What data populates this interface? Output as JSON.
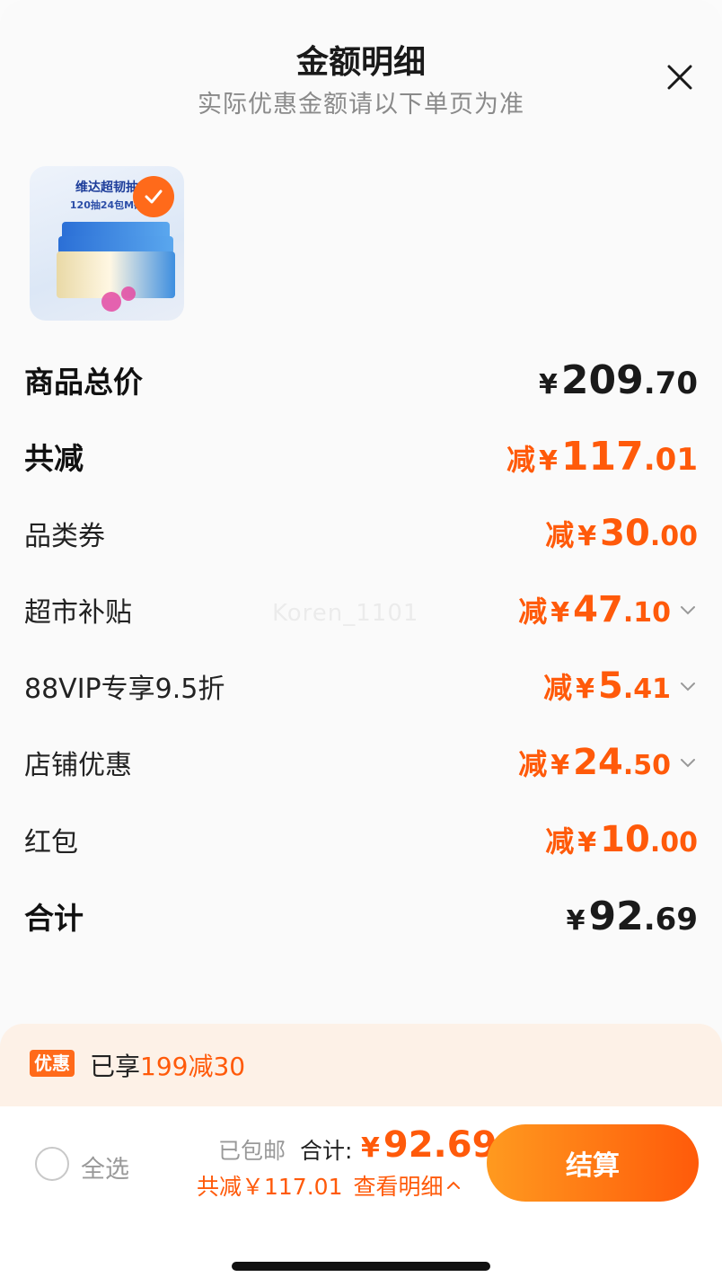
{
  "header": {
    "title": "金额明细",
    "subtitle": "实际优惠金额请以下单页为准"
  },
  "product": {
    "thumb_title": "维达超韧抽",
    "thumb_subtitle": "120抽24包M码"
  },
  "rows": {
    "subtotal": {
      "label": "商品总价",
      "yen": "¥",
      "int": "209",
      "dec": ".70"
    },
    "total_discount": {
      "label": "共减",
      "prefix": "减",
      "yen": "¥",
      "int": "117",
      "dec": ".01"
    },
    "category_coupon": {
      "label": "品类券",
      "prefix": "减",
      "yen": "¥",
      "int": "30",
      "dec": ".00"
    },
    "supermarket_subsidy": {
      "label": "超市补贴",
      "prefix": "减",
      "yen": "¥",
      "int": "47",
      "dec": ".10"
    },
    "vip_discount": {
      "label": "88VIP专享9.5折",
      "prefix": "减",
      "yen": "¥",
      "int": "5",
      "dec": ".41"
    },
    "store_discount": {
      "label": "店铺优惠",
      "prefix": "减",
      "yen": "¥",
      "int": "24",
      "dec": ".50"
    },
    "red_packet": {
      "label": "红包",
      "prefix": "减",
      "yen": "¥",
      "int": "10",
      "dec": ".00"
    },
    "total": {
      "label": "合计",
      "yen": "¥",
      "int": "92",
      "dec": ".69"
    }
  },
  "watermark": "Koren_1101",
  "promo": {
    "tag": "优惠",
    "text_prefix": "已享",
    "text_highlight": "199减30"
  },
  "footer": {
    "select_all": "全选",
    "shipping": "已包邮",
    "total_label": "合计:",
    "total_yen": "¥",
    "total_value": "92.69",
    "discount_text": "共减￥117.01",
    "view_details": "查看明细",
    "checkout": "结算"
  },
  "colors": {
    "accent": "#ff5a0a",
    "promo_bg": "#fdf1e7"
  }
}
